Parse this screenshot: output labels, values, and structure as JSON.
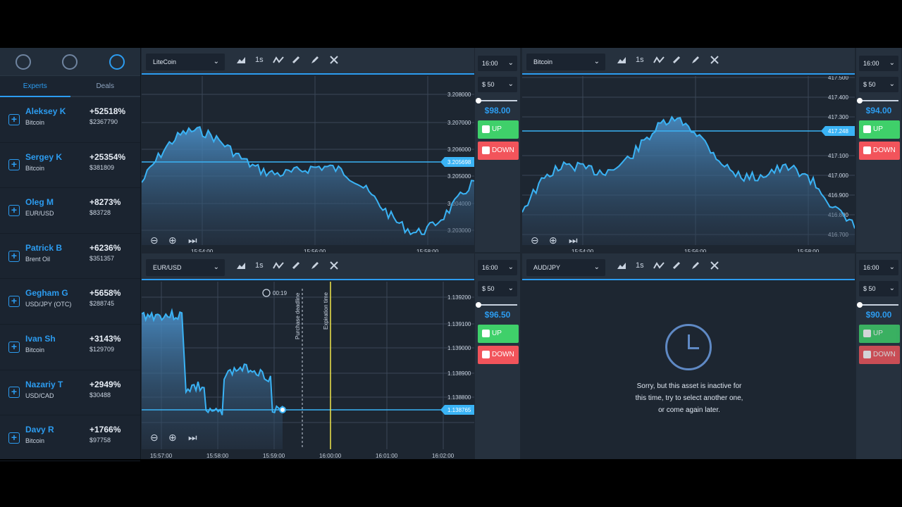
{
  "sidebar": {
    "tabs": [
      "Experts",
      "Deals"
    ],
    "experts": [
      {
        "name": "Aleksey K",
        "asset": "Bitcoin",
        "pct": "+52518%",
        "amount": "$2367790"
      },
      {
        "name": "Sergey K",
        "asset": "Bitcoin",
        "pct": "+25354%",
        "amount": "$381809"
      },
      {
        "name": "Oleg M",
        "asset": "EUR/USD",
        "pct": "+8273%",
        "amount": "$83728"
      },
      {
        "name": "Patrick B",
        "asset": "Brent Oil",
        "pct": "+6236%",
        "amount": "$351357"
      },
      {
        "name": "Gegham G",
        "asset": "USD/JPY (OTC)",
        "pct": "+5658%",
        "amount": "$288745"
      },
      {
        "name": "Ivan Sh",
        "asset": "Bitcoin",
        "pct": "+3143%",
        "amount": "$129709"
      },
      {
        "name": "Nazariy T",
        "asset": "USD/CAD",
        "pct": "+2949%",
        "amount": "$30488"
      },
      {
        "name": "Davy R",
        "asset": "Bitcoin",
        "pct": "+1766%",
        "amount": "$97758"
      }
    ]
  },
  "panels": [
    {
      "asset": "LiteCoin",
      "interval": "1s",
      "time": "16:00",
      "amount": "$ 50",
      "payout": "$98.00",
      "up": "UP",
      "down": "DOWN",
      "yticks": [
        "3.208000",
        "3.207000",
        "3.206000",
        "3.205000",
        "3.204000",
        "3.203000"
      ],
      "current": "3.205698",
      "xticks": [
        "15:54:00",
        "15:56:00",
        "15:58:00"
      ]
    },
    {
      "asset": "Bitcoin",
      "interval": "1s",
      "time": "16:00",
      "amount": "$ 50",
      "payout": "$94.00",
      "up": "UP",
      "down": "DOWN",
      "yticks": [
        "417.500",
        "417.400",
        "417.300",
        "417.100",
        "417.000",
        "416.900",
        "416.800",
        "416.700"
      ],
      "current": "417.248",
      "xticks": [
        "15:54:00",
        "15:56:00",
        "15:58:00"
      ]
    },
    {
      "asset": "EUR/USD",
      "interval": "1s",
      "time": "16:00",
      "amount": "$ 50",
      "payout": "$96.50",
      "up": "UP",
      "down": "DOWN",
      "yticks": [
        "1.139200",
        "1.139100",
        "1.139000",
        "1.138900",
        "1.138800",
        "1.138700"
      ],
      "current": "1.138765",
      "xticks": [
        "15:57:00",
        "15:58:00",
        "15:59:00",
        "16:00:00",
        "16:01:00",
        "16:02:00"
      ],
      "timer": "00:19",
      "purchase_label": "Purchase deadline",
      "expiration_label": "Expiration time"
    },
    {
      "asset": "AUD/JPY",
      "interval": "1s",
      "time": "16:00",
      "amount": "$ 50",
      "payout": "$90.00",
      "up": "UP",
      "down": "DOWN",
      "inactive": [
        "Sorry, but this asset is inactive for",
        "this time, try to select another one,",
        "or come again later."
      ]
    }
  ],
  "icons": [
    "search-icon",
    "filter-icon",
    "star-icon",
    "area-chart-icon",
    "indicator-icon",
    "ruler-icon",
    "pencil-icon",
    "close-icon",
    "zoom-out-icon",
    "zoom-in-icon",
    "skip-icon",
    "chevron-down-icon",
    "clock-icon"
  ],
  "colors": {
    "accent": "#2c9cf0",
    "up": "#3fd06a",
    "down": "#f2545b",
    "panel": "#1d2631",
    "toolbar": "#26313e"
  }
}
